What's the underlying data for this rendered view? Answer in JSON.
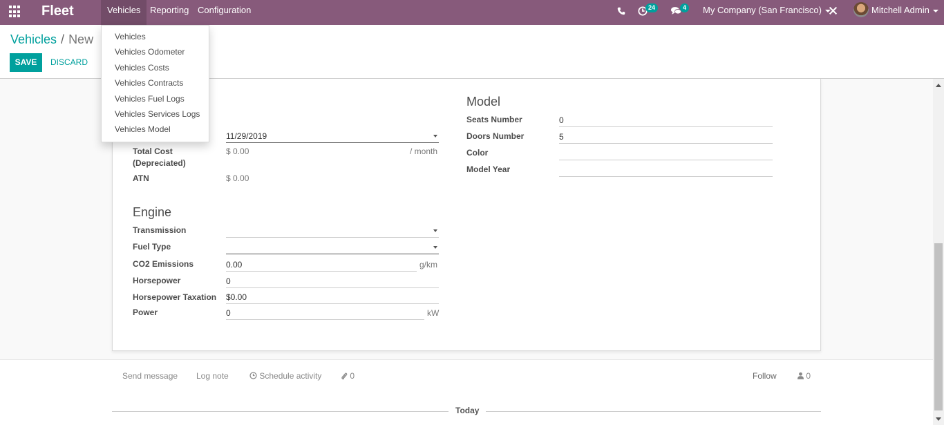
{
  "navbar": {
    "brand": "Fleet",
    "menu": [
      "Vehicles",
      "Reporting",
      "Configuration"
    ],
    "activity_count": "24",
    "message_count": "4",
    "company": "My Company (San Francisco)",
    "user": "Mitchell Admin",
    "accent_color": "#875a7b"
  },
  "dropdown": {
    "items": [
      "Vehicles",
      "Vehicles Odometer",
      "Vehicles Costs",
      "Vehicles Contracts",
      "Vehicles Fuel Logs",
      "Vehicles Services Logs",
      "Vehicles Model"
    ]
  },
  "breadcrumb": {
    "parent": "Vehicles",
    "separator": "/",
    "current": "New"
  },
  "actions": {
    "save": "SAVE",
    "discard": "DISCARD"
  },
  "tax": {
    "date_value": "11/29/2019",
    "total_cost_label_line1": "Total Cost",
    "total_cost_label_line2": "(Depreciated)",
    "total_cost_value": "$ 0.00",
    "total_cost_unit": "/ month",
    "atn_label": "ATN",
    "atn_value": "$ 0.00"
  },
  "engine": {
    "title": "Engine",
    "transmission_label": "Transmission",
    "transmission_value": "",
    "fuel_type_label": "Fuel Type",
    "fuel_type_value": "",
    "co2_label": "CO2 Emissions",
    "co2_value": "0.00",
    "co2_unit": "g/km",
    "horsepower_label": "Horsepower",
    "horsepower_value": "0",
    "horsepower_tax_label": "Horsepower Taxation",
    "horsepower_tax_value": "$0.00",
    "power_label": "Power",
    "power_value": "0",
    "power_unit": "kW"
  },
  "model": {
    "title": "Model",
    "seats_label": "Seats Number",
    "seats_value": "0",
    "doors_label": "Doors Number",
    "doors_value": "5",
    "color_label": "Color",
    "color_value": "",
    "model_year_label": "Model Year",
    "model_year_value": ""
  },
  "chatter": {
    "send_message": "Send message",
    "log_note": "Log note",
    "schedule_activity": "Schedule activity",
    "attachments_count": "0",
    "follow": "Follow",
    "followers_count": "0",
    "today": "Today"
  },
  "colors": {
    "primary": "#00a09d"
  }
}
